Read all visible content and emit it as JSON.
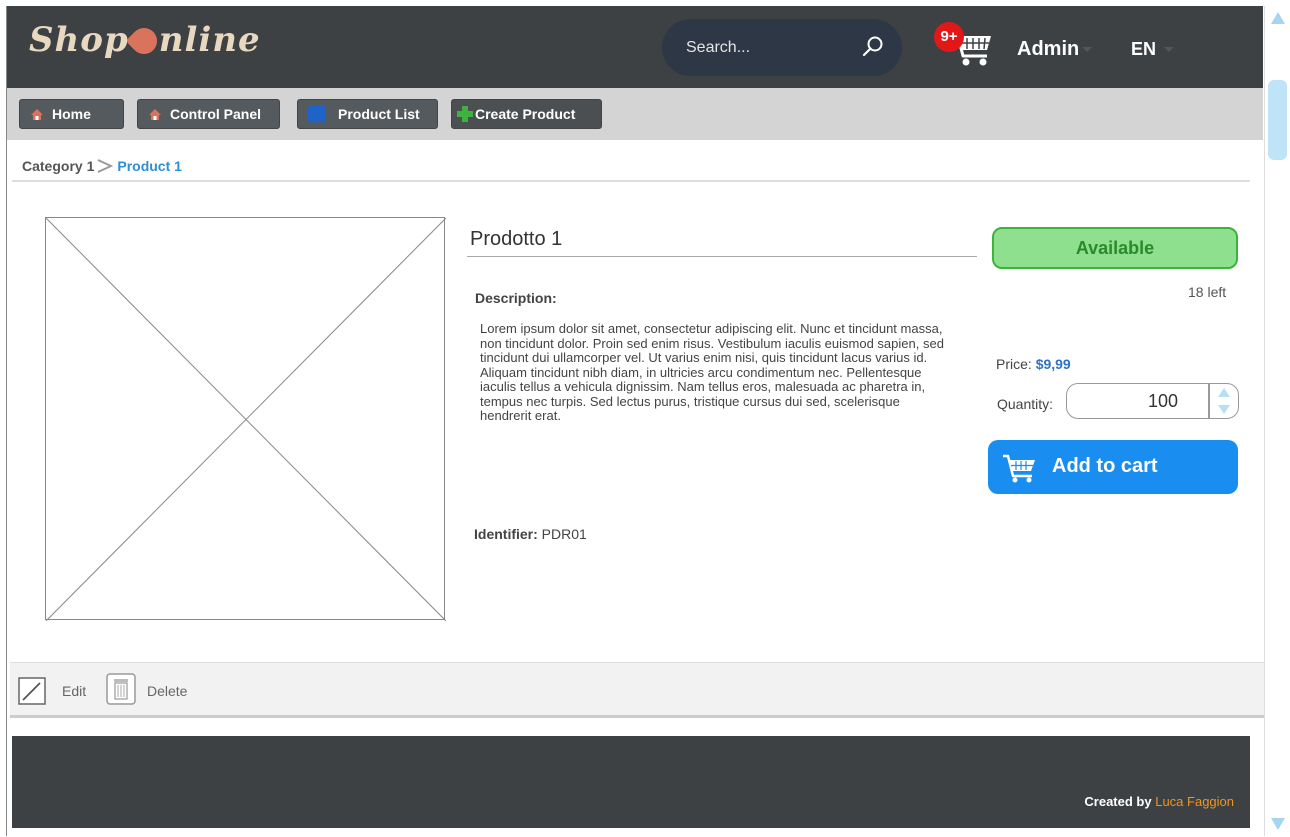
{
  "app": {
    "logo": "ShopOnline"
  },
  "header": {
    "search_placeholder": "Search...",
    "cart_badge": "9+",
    "user": "Admin",
    "language": "EN"
  },
  "toolbar": {
    "home": "Home",
    "control_panel": "Control Panel",
    "product_list": "Product List",
    "create_product": "Create Product"
  },
  "breadcrumb": {
    "category": "Category 1",
    "product": "Product 1"
  },
  "product": {
    "title": "Prodotto 1",
    "description_label": "Description:",
    "description": "Lorem ipsum dolor sit amet, consectetur adipiscing elit. Nunc et tincidunt massa, non tincidunt dolor. Proin sed enim risus. Vestibulum iaculis euismod sapien, sed tincidunt dui ullamcorper vel. Ut varius enim nisi, quis tincidunt lacus varius id. Aliquam tincidunt nibh diam, in ultricies arcu condimentum nec. Pellentesque iaculis tellus a vehicula dignissim. Nam tellus eros, malesuada ac pharetra in, tempus nec turpis. Sed lectus purus, tristique cursus dui sed, scelerisque hendrerit erat.",
    "identifier_label": "Identifier:",
    "identifier": "PDR01",
    "availability": "Available",
    "stock_left": "18 left",
    "price_label": "Price:",
    "price": "$9,99",
    "quantity_label": "Quantity:",
    "quantity": "100",
    "add_to_cart": "Add to cart"
  },
  "actions": {
    "edit": "Edit",
    "delete": "Delete"
  },
  "footer": {
    "created_by": "Created by",
    "author": "Luca Faggion"
  },
  "colors": {
    "header_bg": "#3e4144",
    "accent_blue": "#1a8ef0",
    "available_green": "#8ee08e",
    "author_orange": "#f0951e"
  }
}
